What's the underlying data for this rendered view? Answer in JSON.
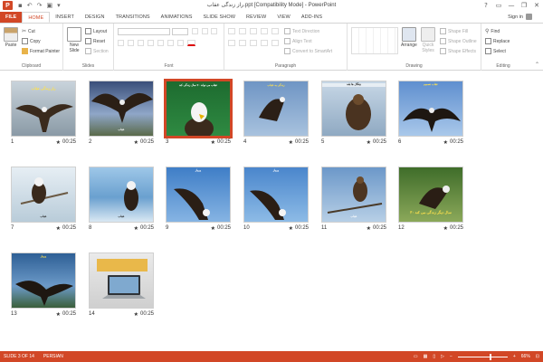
{
  "window": {
    "title": "راز زندگی عقاب.ppt [Compatibility Mode] - PowerPoint",
    "app_icon": "P",
    "controls": [
      "?",
      "▭",
      "—",
      "❐",
      "✕"
    ]
  },
  "tabs": [
    {
      "label": "FILE"
    },
    {
      "label": "HOME"
    },
    {
      "label": "INSERT"
    },
    {
      "label": "DESIGN"
    },
    {
      "label": "TRANSITIONS"
    },
    {
      "label": "ANIMATIONS"
    },
    {
      "label": "SLIDE SHOW"
    },
    {
      "label": "REVIEW"
    },
    {
      "label": "VIEW"
    },
    {
      "label": "ADD-INS"
    }
  ],
  "signin": "Sign in",
  "ribbon": {
    "clipboard": {
      "label": "Clipboard",
      "paste": "Paste",
      "cut": "Cut",
      "copy": "Copy",
      "format_painter": "Format Painter"
    },
    "slides": {
      "label": "Slides",
      "new_slide": "New Slide",
      "layout": "Layout",
      "reset": "Reset",
      "section": "Section"
    },
    "font": {
      "label": "Font"
    },
    "paragraph": {
      "label": "Paragraph",
      "text_direction": "Text Direction",
      "align_text": "Align Text",
      "convert_smartart": "Convert to SmartArt"
    },
    "drawing": {
      "label": "Drawing",
      "arrange": "Arrange",
      "quick_styles": "Quick Styles",
      "shape_fill": "Shape Fill",
      "shape_outline": "Shape Outline",
      "shape_effects": "Shape Effects"
    },
    "editing": {
      "label": "Editing",
      "find": "Find",
      "replace": "Replace",
      "select": "Select"
    }
  },
  "slides": [
    {
      "number": "1",
      "duration": "00:25",
      "caption": "راز زندگی عقاب"
    },
    {
      "number": "2",
      "duration": "00:25",
      "caption": "عقاب"
    },
    {
      "number": "3",
      "duration": "00:25",
      "caption": "عقاب می تواند ۷۰ سال زندگی کند"
    },
    {
      "number": "4",
      "duration": "00:25",
      "caption": "زندگی به عقاب"
    },
    {
      "number": "5",
      "duration": "00:25",
      "caption": "چنگال ها بلند"
    },
    {
      "number": "6",
      "duration": "00:25",
      "caption": "عقاب تصمیم"
    },
    {
      "number": "7",
      "duration": "00:25",
      "caption": "عقاب"
    },
    {
      "number": "8",
      "duration": "00:25",
      "caption": "عقاب"
    },
    {
      "number": "9",
      "duration": "00:25",
      "caption": "پرواز"
    },
    {
      "number": "10",
      "duration": "00:25",
      "caption": "پرواز"
    },
    {
      "number": "11",
      "duration": "00:25",
      "caption": "عقاب"
    },
    {
      "number": "12",
      "duration": "00:25",
      "caption": "۳۰ سال دیگر زندگی می کند"
    },
    {
      "number": "13",
      "duration": "00:25",
      "caption": "پرواز"
    },
    {
      "number": "14",
      "duration": "00:25",
      "caption": ""
    }
  ],
  "status": {
    "slide_of": "SLIDE 3 OF 14",
    "language": "PERSIAN",
    "zoom": "66%"
  },
  "colors": {
    "accent": "#d24726",
    "status": "#d24726"
  }
}
